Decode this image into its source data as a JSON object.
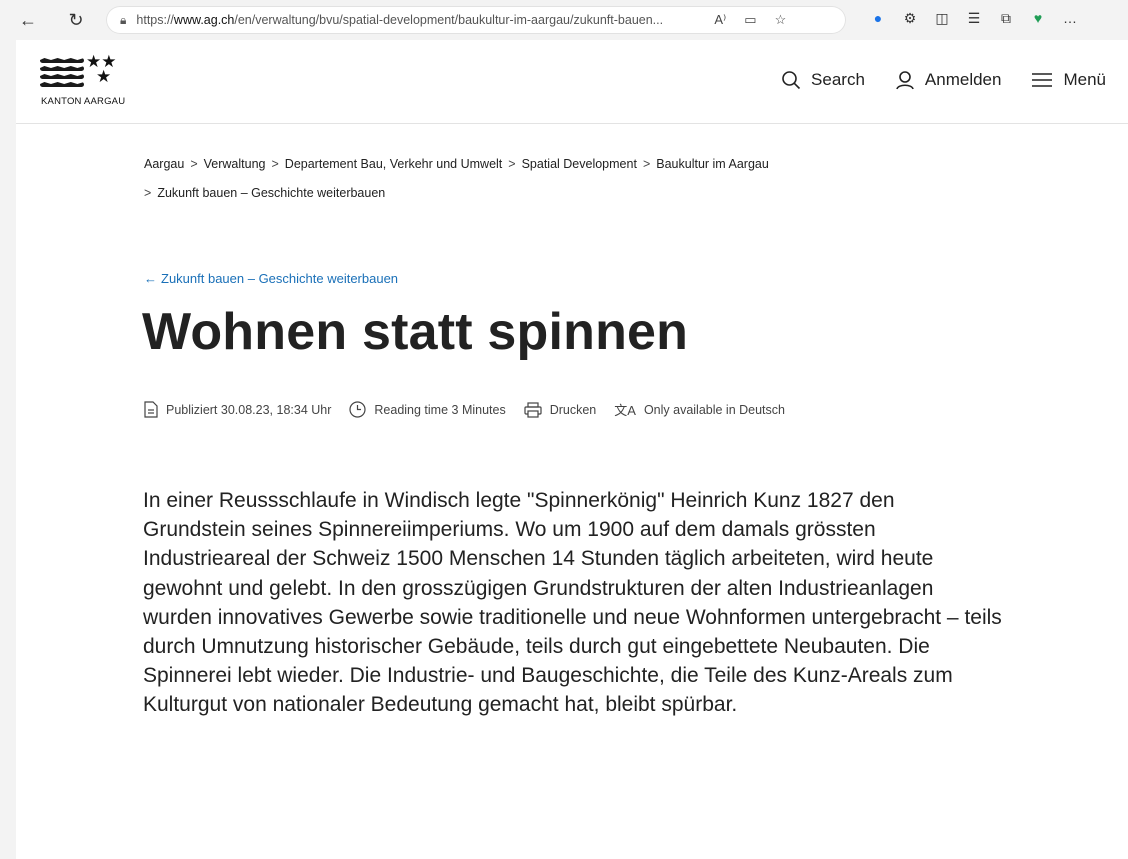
{
  "browser": {
    "url_prefix": "https://",
    "url_host": "www.ag.ch",
    "url_path": "/en/verwaltung/bvu/spatial-development/baukultur-im-aargau/zukunft-bauen...",
    "reader_icon": "A⁾"
  },
  "header": {
    "logo_text": "KANTON AARGAU",
    "search_label": "Search",
    "login_label": "Anmelden",
    "menu_label": "Menü"
  },
  "breadcrumb": {
    "items": [
      "Aargau",
      "Verwaltung",
      "Departement Bau, Verkehr und Umwelt",
      "Spatial Development",
      "Baukultur im Aargau",
      "Zukunft bauen – Geschichte weiterbauen"
    ]
  },
  "article": {
    "back_link": "Zukunft bauen – Geschichte weiterbauen",
    "title": "Wohnen statt spinnen",
    "meta": {
      "published": "Publiziert 30.08.23, 18:34 Uhr",
      "reading_time": "Reading time 3 Minutes",
      "print": "Drucken",
      "language": "Only available in Deutsch"
    },
    "lead": "In einer Reussschlaufe in Windisch legte \"Spinnerkönig\" Heinrich Kunz 1827 den Grundstein seines Spinnereiimperiums. Wo um 1900 auf dem damals grössten Industrieareal der Schweiz 1500 Menschen 14 Stunden täglich arbeiteten, wird heute gewohnt und gelebt. In den grosszügigen Grundstrukturen der alten Industrieanlagen wurden innovatives Gewerbe sowie traditionelle und neue Wohnformen untergebracht – teils durch Umnutzung historischer Gebäude, teils durch gut eingebettete Neubauten. Die Spinnerei lebt wieder. Die Industrie- und Baugeschichte, die Teile des Kunz-Areals zum Kulturgut von nationaler Bedeutung gemacht hat, bleibt spürbar."
  },
  "colors": {
    "link": "#1a70b8",
    "text": "#222222"
  }
}
